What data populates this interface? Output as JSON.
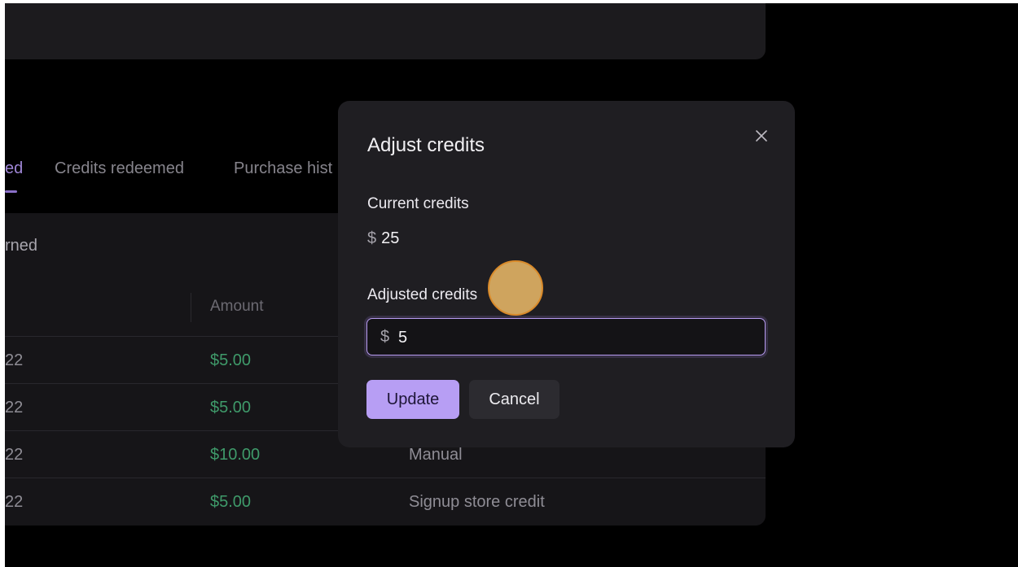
{
  "tabs": [
    {
      "label": "ed",
      "active": true
    },
    {
      "label": "Credits redeemed",
      "active": false
    },
    {
      "label": "Purchase hist",
      "active": false
    }
  ],
  "section_title": "rned",
  "table": {
    "columns": [
      "Amount"
    ],
    "rows": [
      {
        "date": "22",
        "amount": "$5.00",
        "source": ""
      },
      {
        "date": "22",
        "amount": "$5.00",
        "source": ""
      },
      {
        "date": "22",
        "amount": "$10.00",
        "source": "Manual"
      },
      {
        "date": "22",
        "amount": "$5.00",
        "source": "Signup store credit"
      }
    ]
  },
  "modal": {
    "title": "Adjust credits",
    "close_icon": "close-icon",
    "current_label": "Current credits",
    "current_symbol": "$",
    "current_value": "25",
    "adjusted_label": "Adjusted credits",
    "input_prefix": "$",
    "input_value": "5",
    "update_label": "Update",
    "cancel_label": "Cancel"
  },
  "colors": {
    "accent": "#b79ef4",
    "positive_amount": "#3f9a6a",
    "background": "#000000",
    "modal_bg": "#1f1e22"
  }
}
